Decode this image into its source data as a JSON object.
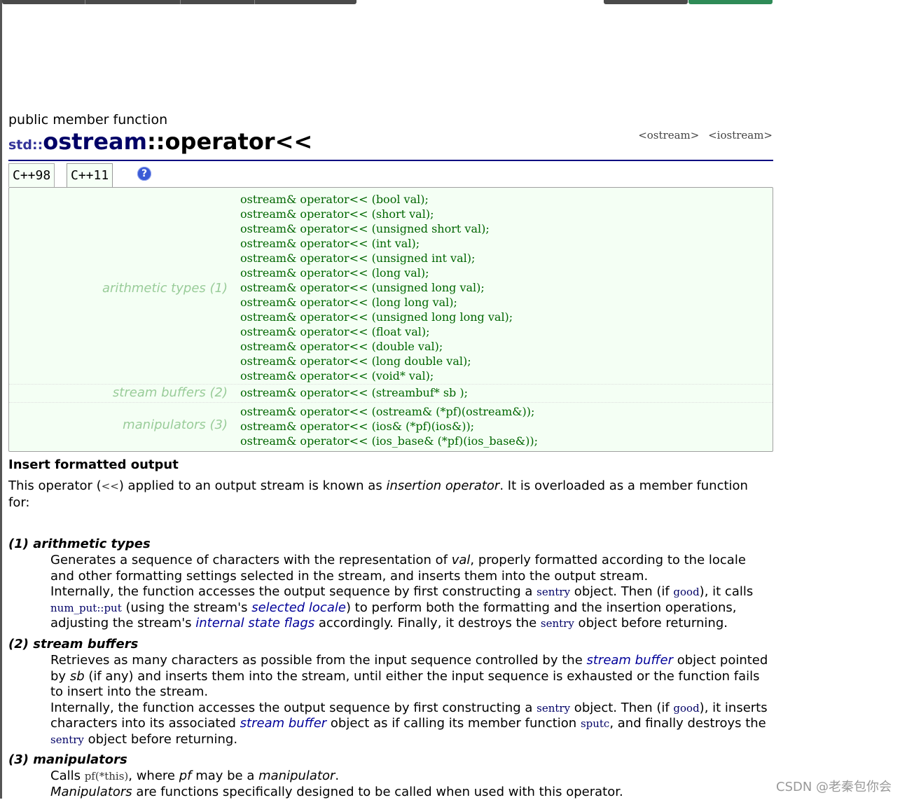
{
  "header": {
    "type_label": "public member function",
    "ns": "std::",
    "class_name": "ostream",
    "sep": "::",
    "member": "operator<<",
    "headers": [
      "<ostream>",
      "<iostream>"
    ]
  },
  "tabs": [
    {
      "label": "C++98"
    },
    {
      "label": "C++11"
    }
  ],
  "help_icon": "?",
  "declarations": {
    "groups": [
      {
        "label": "arithmetic types (1)",
        "lines": [
          "ostream& operator<< (bool val);",
          "ostream& operator<< (short val);",
          "ostream& operator<< (unsigned short val);",
          "ostream& operator<< (int val);",
          "ostream& operator<< (unsigned int val);",
          "ostream& operator<< (long val);",
          "ostream& operator<< (unsigned long val);",
          "ostream& operator<< (long long val);",
          "ostream& operator<< (unsigned long long val);",
          "ostream& operator<< (float val);",
          "ostream& operator<< (double val);",
          "ostream& operator<< (long double val);",
          "ostream& operator<< (void* val);"
        ]
      },
      {
        "label": "stream buffers (2)",
        "lines": [
          "ostream& operator<< (streambuf* sb );"
        ]
      },
      {
        "label": "manipulators (3)",
        "lines": [
          "ostream& operator<< (ostream& (*pf)(ostream&));",
          "ostream& operator<< (ios& (*pf)(ios&));",
          "ostream& operator<< (ios_base& (*pf)(ios_base&));"
        ]
      }
    ]
  },
  "description": {
    "heading": "Insert formatted output",
    "intro_1": "This operator (",
    "intro_op": "<<",
    "intro_2": ") applied to an output stream is known as ",
    "intro_em": "insertion operator",
    "intro_3": ". It is overloaded as a member function for:"
  },
  "items": {
    "arith": {
      "title": "(1) arithmetic types",
      "p1a": "Generates a sequence of characters with the representation of ",
      "p1em": "val",
      "p1b": ", properly formatted according to the locale and other formatting settings selected in the stream, and inserts them into the output stream.",
      "p2a": "Internally, the function accesses the output sequence by first constructing a ",
      "sentry": "sentry",
      "p2b": " object. Then (if ",
      "good": "good",
      "p2c": "), it calls ",
      "num_put": "num_put::put",
      "p2d": " (using the stream's ",
      "selected_locale": "selected locale",
      "p2e": ") to perform both the formatting and the insertion operations, adjusting the stream's ",
      "internal_flags": "internal state flags",
      "p2f": " accordingly. Finally, it destroys the ",
      "p2g": " object before returning."
    },
    "buffers": {
      "title": "(2) stream buffers",
      "p1a": "Retrieves as many characters as possible from the input sequence controlled by the ",
      "stream_buffer": "stream buffer",
      "p1b": " object pointed by ",
      "sb": "sb",
      "p1c": " (if any) and inserts them into the stream, until either the input sequence is exhausted or the function fails to insert into the stream.",
      "p2a": "Internally, the function accesses the output sequence by first constructing a ",
      "sentry": "sentry",
      "p2b": " object. Then (if ",
      "good": "good",
      "p2c": "), it inserts characters into its associated ",
      "p2d": " object as if calling its member function ",
      "sputc": "sputc",
      "p2e": ", and finally destroys the ",
      "p2f": " object before returning."
    },
    "manip": {
      "title": "(3) manipulators",
      "p1a": "Calls ",
      "pf_this": "pf(*this)",
      "p1b": ", where ",
      "pf": "pf",
      "p1c": " may be a ",
      "manipulator": "manipulator",
      "p1d": ".",
      "p2em": "Manipulators",
      "p2": " are functions specifically designed to be called when used with this operator."
    }
  },
  "watermark": "CSDN @老秦包你会",
  "colors": {
    "title_rule": "#000080",
    "decl_bg": "#f4fff4",
    "decl_text": "#006600",
    "group_label": "#99cc99",
    "link": "#000099"
  }
}
